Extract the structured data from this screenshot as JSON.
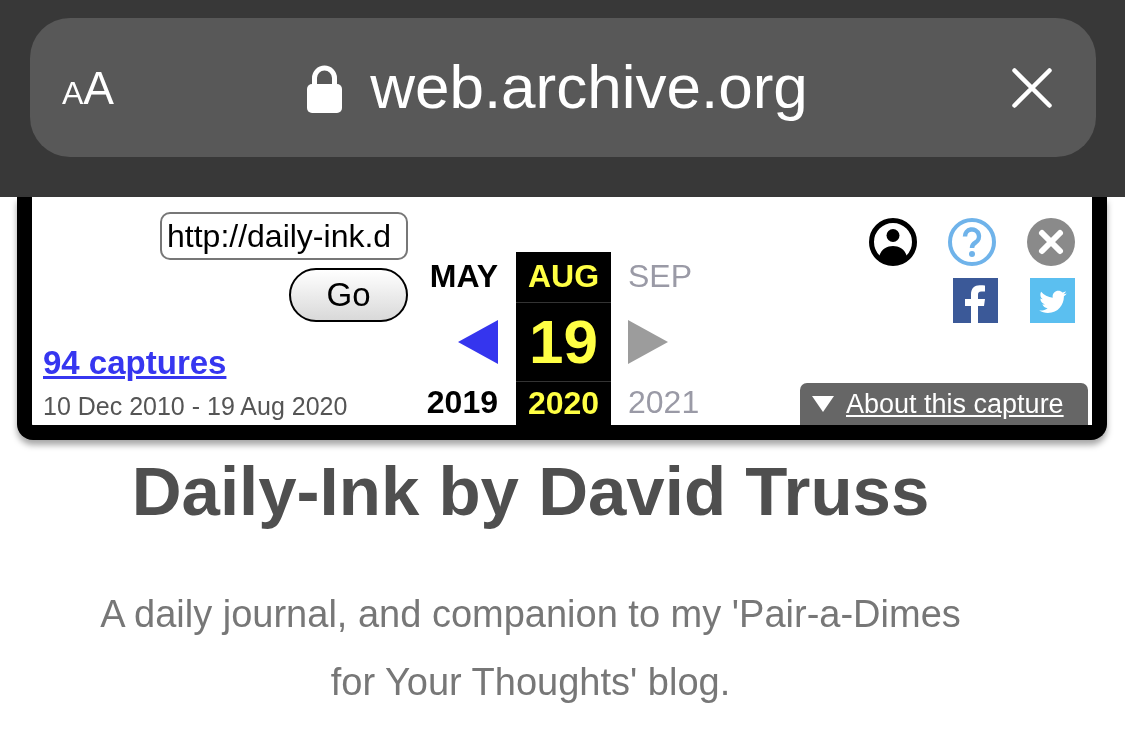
{
  "browser_bar": {
    "text_size_button": "AA",
    "address": "web.archive.org"
  },
  "wayback_toolbar": {
    "url_field": {
      "value": "http://daily-ink.d"
    },
    "go_button": "Go",
    "captures_link": "94 captures",
    "date_range": "10 Dec 2010 - 19 Aug 2020",
    "calendar": [
      {
        "kind": "previous",
        "month": "MAY",
        "year": "2019",
        "selected": false,
        "disabled": false
      },
      {
        "kind": "current",
        "month": "AUG",
        "day": "19",
        "year": "2020",
        "selected": true,
        "disabled": false
      },
      {
        "kind": "next",
        "month": "SEP",
        "year": "2021",
        "selected": false,
        "disabled": true
      }
    ],
    "about_button": "About this capture"
  },
  "blog": {
    "title": "Daily-Ink by David Truss",
    "tagline": "A daily journal, and companion to my 'Pair-a-Dimes for Your Thoughts' blog."
  }
}
